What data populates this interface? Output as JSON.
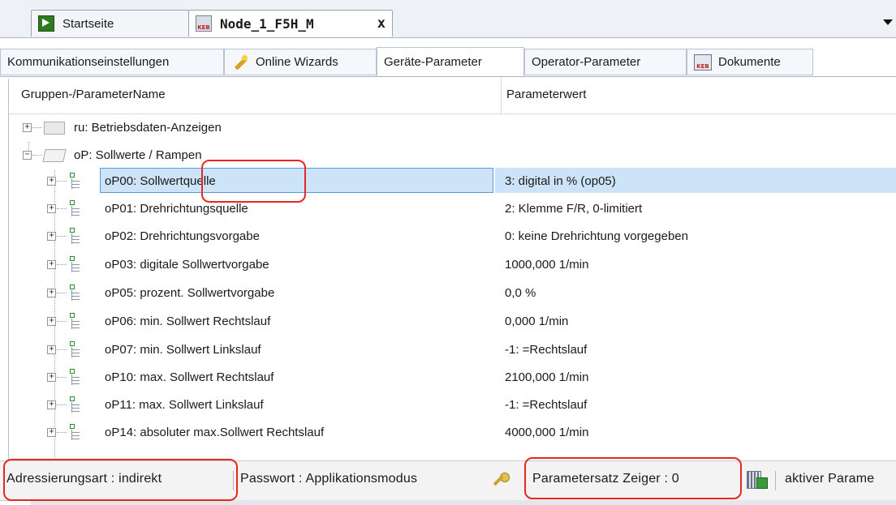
{
  "doc_tabs": [
    {
      "label": "Startseite",
      "icon": "arrow-icon"
    },
    {
      "label": "Node_1_F5H_M",
      "icon": "keb-icon",
      "close": "x"
    }
  ],
  "sub_tabs": [
    {
      "label": "Kommunikationseinstellungen"
    },
    {
      "label": "Online Wizards",
      "icon": "wizard-icon"
    },
    {
      "label": "Geräte-Parameter",
      "active": true
    },
    {
      "label": "Operator-Parameter"
    },
    {
      "label": "Dokumente",
      "icon": "document-icon"
    }
  ],
  "keb_icon_text": "KEB",
  "grid": {
    "col_name": "Gruppen-/ParameterName",
    "col_value": "Parameterwert"
  },
  "groups": [
    {
      "name": "ru: Betriebsdaten-Anzeigen",
      "expanded": false
    },
    {
      "name": "oP: Sollwerte / Rampen",
      "expanded": true
    }
  ],
  "params": [
    {
      "name": "oP00: Sollwertquelle",
      "value": "3: digital in % (op05)",
      "selected": true
    },
    {
      "name": "oP01: Drehrichtungsquelle",
      "value": "2: Klemme F/R, 0-limitiert"
    },
    {
      "name": "oP02: Drehrichtungsvorgabe",
      "value": "0: keine Drehrichtung vorgegeben"
    },
    {
      "name": "oP03: digitale Sollwertvorgabe",
      "value": "1000,000 1/min"
    },
    {
      "name": "oP05: prozent. Sollwertvorgabe",
      "value": "0,0 %"
    },
    {
      "name": "oP06: min. Sollwert Rechtslauf",
      "value": "0,000 1/min"
    },
    {
      "name": "oP07: min. Sollwert Linkslauf",
      "value": "-1: =Rechtslauf"
    },
    {
      "name": "oP10: max. Sollwert Rechtslauf",
      "value": "2100,000 1/min"
    },
    {
      "name": "oP11: max. Sollwert Linkslauf",
      "value": "-1: =Rechtslauf"
    },
    {
      "name": "oP14: absoluter max.Sollwert Rechtslauf",
      "value": "4000,000 1/min"
    }
  ],
  "status": {
    "addressing": "Adressierungsart  : indirekt",
    "password": "Passwort : Applikationsmodus",
    "param_set_pointer": "Parametersatz Zeiger   : 0",
    "active_param": "aktiver Parame"
  }
}
